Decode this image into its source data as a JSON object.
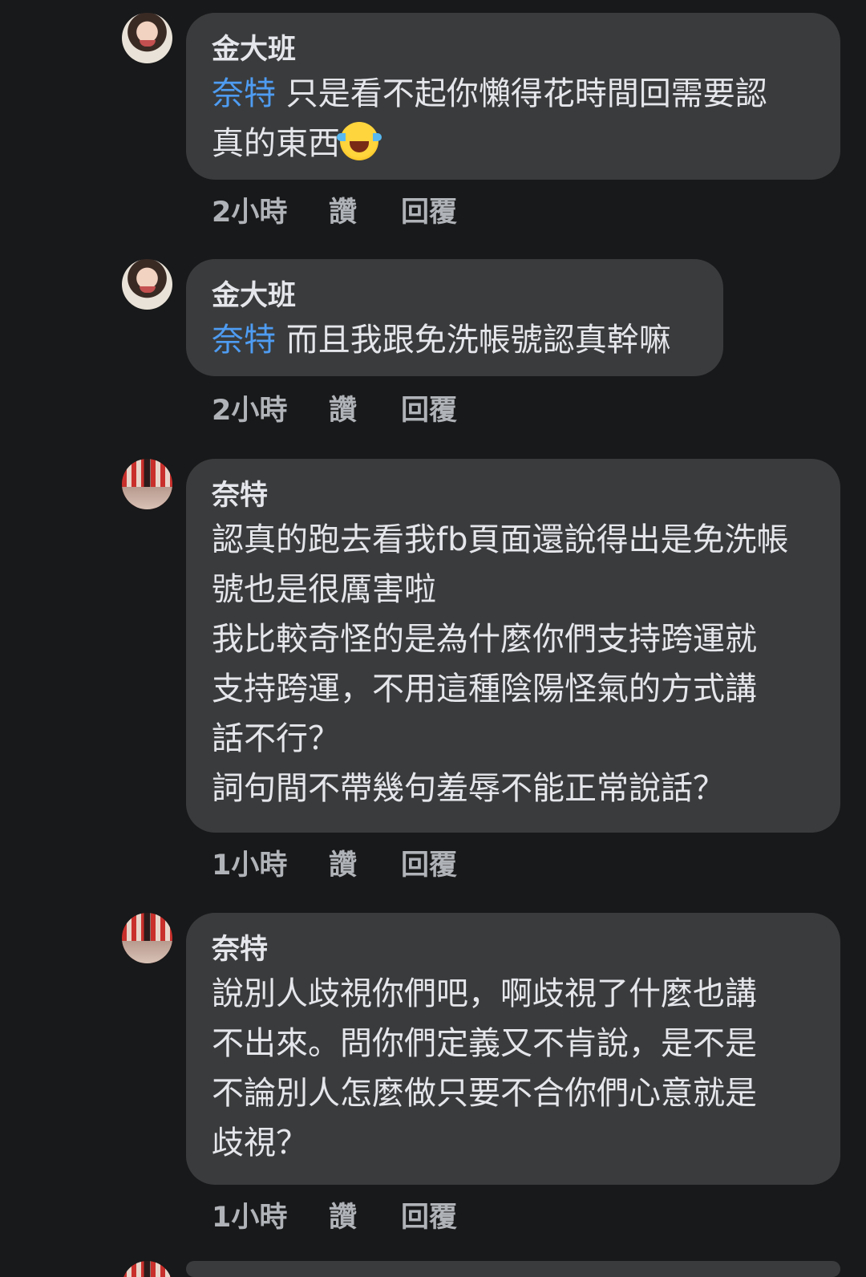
{
  "comments": [
    {
      "author": "金大班",
      "mention": "奈特",
      "lines": [
        "只是看不起你懶得花時間回需要認",
        "真的東西"
      ],
      "emoji": "face-with-tears-of-joy",
      "time": "2小時",
      "like": "讚",
      "reply": "回覆"
    },
    {
      "author": "金大班",
      "mention": "奈特",
      "lines": [
        "而且我跟免洗帳號認真幹嘛"
      ],
      "time": "2小時",
      "like": "讚",
      "reply": "回覆"
    },
    {
      "author": "奈特",
      "lines": [
        "認真的跑去看我fb頁面還說得出是免洗帳",
        "號也是很厲害啦",
        "我比較奇怪的是為什麼你們支持跨運就",
        "支持跨運，不用這種陰陽怪氣的方式講",
        "話不行？",
        "詞句間不帶幾句羞辱不能正常說話？"
      ],
      "time": "1小時",
      "like": "讚",
      "reply": "回覆"
    },
    {
      "author": "奈特",
      "lines": [
        "說別人歧視你們吧，啊歧視了什麼也講",
        "不出來。問你們定義又不肯說，是不是",
        "不論別人怎麼做只要不合你們心意就是",
        "歧視？"
      ],
      "time": "1小時",
      "like": "讚",
      "reply": "回覆"
    }
  ]
}
